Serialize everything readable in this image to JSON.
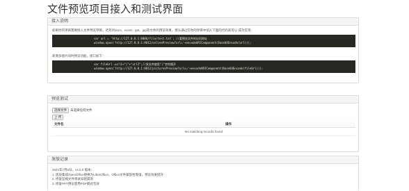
{
  "page": {
    "title": "文件预览项目接入和测试界面"
  },
  "access": {
    "heading": "接入说明",
    "intro": "如果你的项目需要接入文件预览项目，达到对docx、excel、ppt、jpg等文件的预览效果，那么通过在你的项目中加入下面的代码就可以 成功实现：",
    "code1_line1": "var url = 'http://127.0.0.1:8080/file/test.txt'; //要预览文件的访问地址",
    "code1_line2": "window.open('http://127.0.0.1:8012/onlinePreview?url='+encodeURIComponent(Base64Encode(url)));",
    "multi_note": "新增多图片同时预览功能，接口如下：",
    "code2_line1": "var fileUrl =url1+\"|\"+\"url2\";//多文件使用\"|\"字符隔开",
    "code2_line2": "window.open('http://127.0.0.1:8012/picturesPreview?urls='+encodeURIComponent(Base64Encode(fileUrl)));"
  },
  "test": {
    "heading": "预览测试",
    "choose_button": "选择文件",
    "no_file": "未选择任何文件",
    "upload_button": "上 传",
    "columns": [
      "文件名",
      "操作"
    ],
    "empty_text": "No matching records found"
  },
  "changelog": {
    "heading": "发版记录",
    "items": [
      "2021年7月6日，v4.0.0 版本：",
      "1. 底层集成OpenOffice替换为LibreOffice，Office文件兼容性增强，预览效果提升",
      "2. 修复压缩文件目录穿越漏洞",
      "3. 修复PPT预览使用PDF模式无效"
    ]
  }
}
